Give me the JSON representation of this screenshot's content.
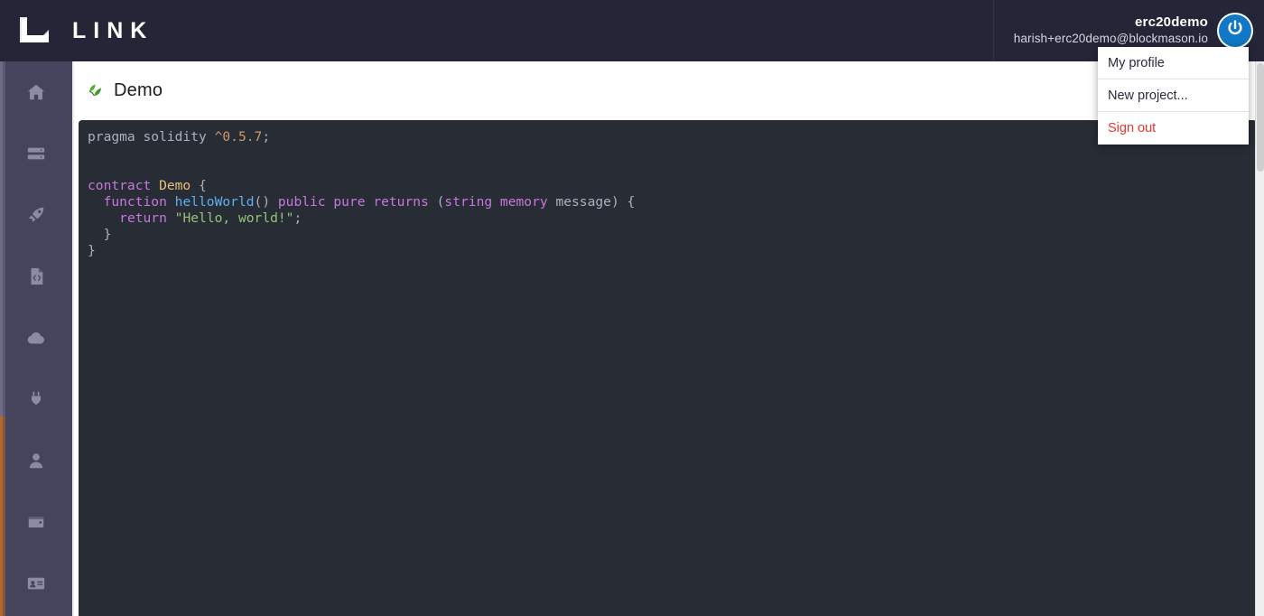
{
  "header": {
    "brand_name": "LINK",
    "logo_icon": "link-logo-icon",
    "user": {
      "name": "erc20demo",
      "email": "harish+erc20demo@blockmason.io",
      "avatar_icon": "power-icon",
      "avatar_color": "#1277c4"
    },
    "background_color": "#252538"
  },
  "user_menu": {
    "visible": true,
    "items": [
      {
        "label": "My profile",
        "name": "menu-item-my-profile",
        "danger": false
      },
      {
        "label": "New project...",
        "name": "menu-item-new-project",
        "danger": false
      },
      {
        "label": "Sign out",
        "name": "menu-item-sign-out",
        "danger": true
      }
    ],
    "danger_color": "#e8372e"
  },
  "sidebar": {
    "background_color": "#46435c",
    "items": [
      {
        "label": "Home",
        "icon": "home-icon"
      },
      {
        "label": "Databases",
        "icon": "server-icon"
      },
      {
        "label": "Deploy",
        "icon": "rocket-icon"
      },
      {
        "label": "Contracts",
        "icon": "file-code-icon"
      },
      {
        "label": "Cloud",
        "icon": "cloud-icon"
      },
      {
        "label": "Integrations",
        "icon": "plug-icon"
      },
      {
        "label": "Account",
        "icon": "user-icon"
      },
      {
        "label": "Wallet",
        "icon": "wallet-icon"
      },
      {
        "label": "Billing",
        "icon": "id-card-icon"
      }
    ]
  },
  "page": {
    "title": "Demo",
    "title_icon": "solidity-leaf-icon",
    "action_button_label": "",
    "action_button_color": "#4b4bd4"
  },
  "editor": {
    "background_color": "#282c34",
    "language": "solidity",
    "lines": [
      [
        {
          "t": "pragma solidity ",
          "c": "plain"
        },
        {
          "t": "^0.5.7",
          "c": "num"
        },
        {
          "t": ";",
          "c": "punct"
        }
      ],
      [],
      [],
      [
        {
          "t": "contract ",
          "c": "key"
        },
        {
          "t": "Demo",
          "c": "type"
        },
        {
          "t": " {",
          "c": "punct"
        }
      ],
      [
        {
          "t": "  ",
          "c": "plain"
        },
        {
          "t": "function ",
          "c": "key"
        },
        {
          "t": "helloWorld",
          "c": "fn"
        },
        {
          "t": "() ",
          "c": "punct"
        },
        {
          "t": "public pure returns ",
          "c": "key"
        },
        {
          "t": "(",
          "c": "punct"
        },
        {
          "t": "string memory",
          "c": "key"
        },
        {
          "t": " message) {",
          "c": "plain"
        }
      ],
      [
        {
          "t": "    ",
          "c": "plain"
        },
        {
          "t": "return ",
          "c": "key"
        },
        {
          "t": "\"Hello, world!\"",
          "c": "str"
        },
        {
          "t": ";",
          "c": "punct"
        }
      ],
      [
        {
          "t": "  }",
          "c": "punct"
        }
      ],
      [
        {
          "t": "}",
          "c": "punct"
        }
      ]
    ]
  },
  "scrollbars": {
    "right_visible": true,
    "left_visible": true
  }
}
